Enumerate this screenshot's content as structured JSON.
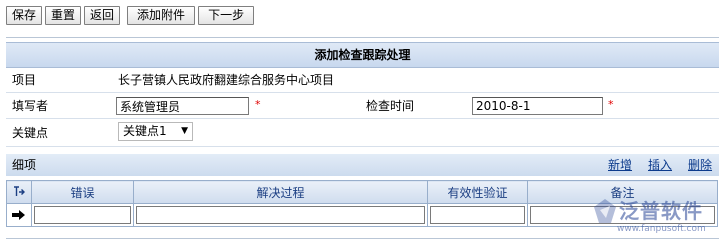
{
  "toolbar": {
    "save": "保存",
    "reset": "重置",
    "back": "返回",
    "add_attachment": "添加附件",
    "next_step": "下一步"
  },
  "form": {
    "title": "添加检查跟踪处理",
    "project_label": "项目",
    "project_value": "长子营镇人民政府翻建综合服务中心项目",
    "filler_label": "填写者",
    "filler_value": "系统管理员",
    "required_mark": "*",
    "check_time_label": "检查时间",
    "check_time_value": "2010-8-1",
    "key_point_label": "关键点",
    "key_point_selected": "关键点1"
  },
  "details": {
    "label": "细项",
    "actions": {
      "add": "新增",
      "insert": "插入",
      "delete": "删除"
    },
    "columns": [
      "错误",
      "解决过程",
      "有效性验证",
      "备注"
    ]
  },
  "watermark": {
    "brand": "泛普软件",
    "url": "www.fanpusoft.com"
  },
  "colors": {
    "header_bg": "#c8d8ee",
    "link": "#0b3a8c",
    "required": "#e00000",
    "grid_border": "#98aecb"
  }
}
